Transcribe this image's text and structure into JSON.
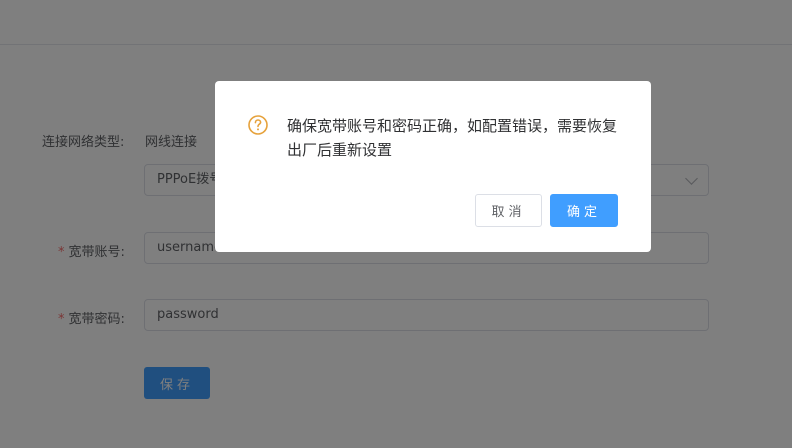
{
  "form": {
    "network_type_label": "连接网络类型:",
    "network_type_value": "网线连接",
    "mode_select_value": "PPPoE拨号",
    "account_label": "宽带账号:",
    "account_value": "username",
    "password_label": "宽带密码:",
    "password_value": "password",
    "required_mark": "*",
    "save_label": "保存"
  },
  "dialog": {
    "message": "确保宽带账号和密码正确，如配置错误，需要恢复出厂后重新设置",
    "cancel_label": "取消",
    "confirm_label": "确定",
    "icon": "question-circle-icon"
  },
  "colors": {
    "primary": "#409eff",
    "warning": "#e6a23c",
    "required": "#f56c6c"
  }
}
